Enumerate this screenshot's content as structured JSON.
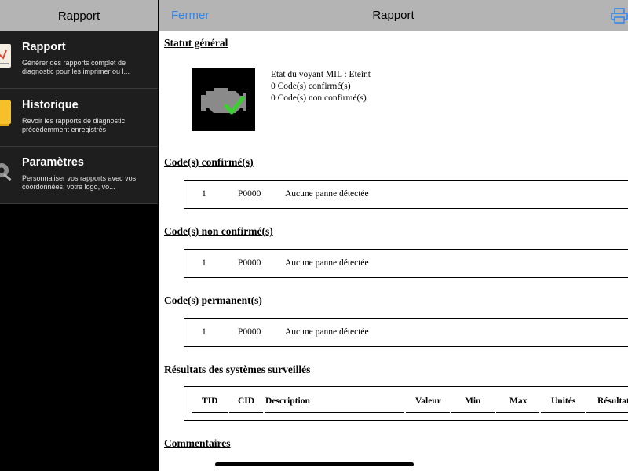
{
  "sidebar": {
    "title": "Rapport",
    "items": [
      {
        "title": "Rapport",
        "desc": "Générer des rapports complet de diagnostic pour les imprimer ou l...",
        "icon": "report-icon"
      },
      {
        "title": "Historique",
        "desc": "Revoir les rapports de diagnostic précédemment enregistrés",
        "icon": "folder-icon"
      },
      {
        "title": "Paramètres",
        "desc": "Personnaliser vos rapports avec vos coordonnées, votre logo, vo...",
        "icon": "gear-icon"
      }
    ]
  },
  "topbar": {
    "close_label": "Fermer",
    "title": "Rapport",
    "print_icon": "printer-icon"
  },
  "report": {
    "status": {
      "title": "Statut général",
      "mil": "Etat du voyant MIL : Eteint",
      "confirmed": "0 Code(s) confirmé(s)",
      "unconfirmed": "0 Code(s) non confirmé(s)",
      "icon": "engine-check-icon"
    },
    "confirmed": {
      "title": "Code(s) confirmé(s)",
      "index": "1",
      "code": "P0000",
      "desc": "Aucune panne détectée"
    },
    "unconfirmed": {
      "title": "Code(s) non confirmé(s)",
      "index": "1",
      "code": "P0000",
      "desc": "Aucune panne détectée"
    },
    "permanent": {
      "title": "Code(s) permanent(s)",
      "index": "1",
      "code": "P0000",
      "desc": "Aucune panne détectée"
    },
    "monitors": {
      "title": "Résultats des systèmes surveillés",
      "columns": [
        "TID",
        "CID",
        "Description",
        "Valeur",
        "Min",
        "Max",
        "Unités",
        "Résultat"
      ]
    },
    "comments": {
      "title": "Commentaires"
    }
  },
  "colors": {
    "accent": "#2f86e8",
    "bar": "#b4b4b4",
    "sidebar_item": "#1e1e1e"
  }
}
